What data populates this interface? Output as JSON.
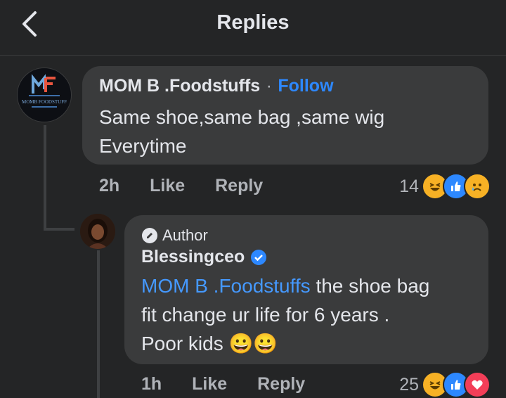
{
  "header": {
    "title": "Replies"
  },
  "comment": {
    "author": "MOM B .Foodstuffs",
    "separator": "·",
    "follow_label": "Follow",
    "text_line1": "Same shoe,same bag ,same wig",
    "text_line2": "Everytime",
    "time": "2h",
    "like_label": "Like",
    "reply_label": "Reply",
    "reaction_count": "14",
    "reactions": [
      "haha-icon",
      "like-icon",
      "sad-icon"
    ],
    "avatar_logo_text": "MOMB FOODSTUFF"
  },
  "reply": {
    "badge_label": "Author",
    "author": "Blessingceo",
    "mention": "MOM B .Foodstuffs",
    "text_line1": " the shoe bag",
    "text_line2": "fit change ur life for 6 years .",
    "text_line3": "Poor kids ",
    "emoji": "😀😀",
    "time": "1h",
    "like_label": "Like",
    "reply_label": "Reply",
    "reaction_count": "25",
    "reactions": [
      "haha-icon",
      "like-icon",
      "love-icon"
    ]
  },
  "colors": {
    "background": "#242526",
    "bubble": "#3a3b3c",
    "accent": "#2d88ff",
    "mention": "#4599ff",
    "muted": "#b0b3b8",
    "love": "#f33e58",
    "haha": "#f7b125"
  }
}
